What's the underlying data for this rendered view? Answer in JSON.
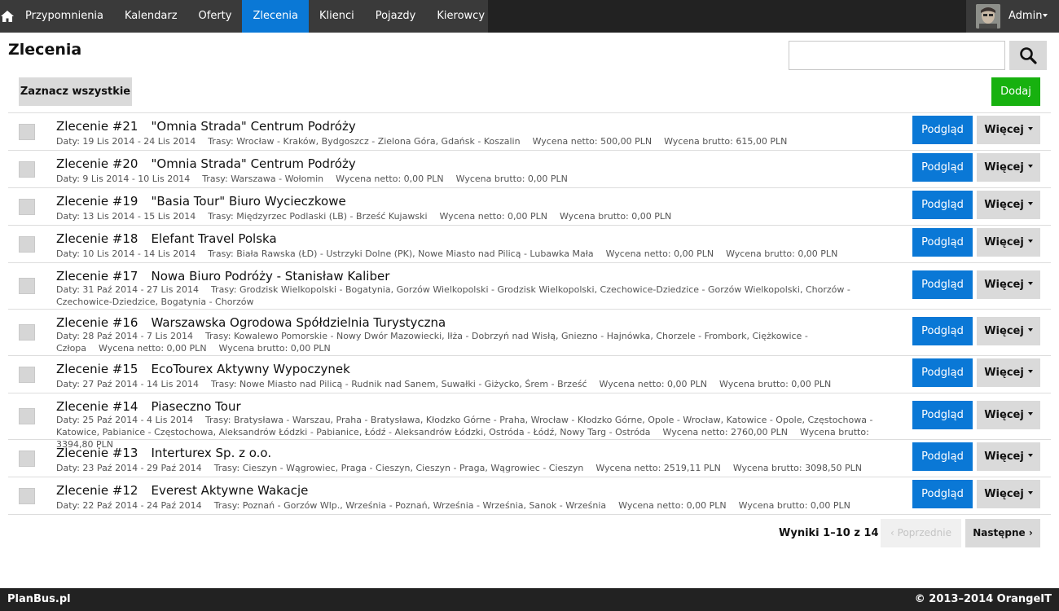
{
  "nav": {
    "home_icon": "home-icon",
    "items": [
      "Przypomnienia",
      "Kalendarz",
      "Oferty",
      "Zlecenia",
      "Klienci",
      "Pojazdy",
      "Kierowcy"
    ],
    "active": "Zlecenia",
    "active_color": "#0a78d6"
  },
  "user": {
    "name": "Admin",
    "menu_icon": "caret-down-icon"
  },
  "page": {
    "title": "Zlecenia"
  },
  "search": {
    "placeholder": "",
    "value": "",
    "icon": "search-icon"
  },
  "toolbar": {
    "select_all_label": "Zaznacz wszystkie",
    "add_label": "Dodaj",
    "add_color": "#17b10f"
  },
  "orders": [
    {
      "number": "Zlecenie #21",
      "client": "\"Omnia Strada\" Centrum Podróży",
      "dates": "Daty: 19 Lis 2014 - 24 Lis 2014",
      "routes": "Trasy: Wrocław - Kraków, Bydgoszcz - Zielona Góra, Gdańsk - Koszalin",
      "netto": "Wycena netto: 500,00 PLN",
      "brutto": "Wycena brutto: 615,00 PLN",
      "preview_label": "Podgląd",
      "more_label": "Więcej"
    },
    {
      "number": "Zlecenie #20",
      "client": "\"Omnia Strada\" Centrum Podróży",
      "dates": "Daty: 9 Lis 2014 - 10 Lis 2014",
      "routes": "Trasy: Warszawa - Wołomin",
      "netto": "Wycena netto: 0,00 PLN",
      "brutto": "Wycena brutto: 0,00 PLN",
      "preview_label": "Podgląd",
      "more_label": "Więcej"
    },
    {
      "number": "Zlecenie #19",
      "client": "\"Basia Tour\" Biuro Wycieczkowe",
      "dates": "Daty: 13 Lis 2014 - 15 Lis 2014",
      "routes": "Trasy: Międzyrzec Podlaski (LB) - Brześć Kujawski",
      "netto": "Wycena netto: 0,00 PLN",
      "brutto": "Wycena brutto: 0,00 PLN",
      "preview_label": "Podgląd",
      "more_label": "Więcej"
    },
    {
      "number": "Zlecenie #18",
      "client": "Elefant Travel Polska",
      "dates": "Daty: 10 Lis 2014 - 14 Lis 2014",
      "routes": "Trasy: Biała Rawska (ŁD) - Ustrzyki Dolne (PK), Nowe Miasto nad Pilicą - Lubawka Mała",
      "netto": "Wycena netto: 0,00 PLN",
      "brutto": "Wycena brutto: 0,00 PLN",
      "preview_label": "Podgląd",
      "more_label": "Więcej"
    },
    {
      "number": "Zlecenie #17",
      "client": "Nowa Biuro Podróży - Stanisław Kaliber",
      "dates": "Daty: 31 Paź 2014 - 27 Lis 2014",
      "routes": "Trasy: Grodzisk Wielkopolski - Bogatynia, Gorzów Wielkopolski - Grodzisk Wielkopolski, Czechowice-Dziedzice - Gorzów Wielkopolski, Chorzów - Czechowice-Dziedzice, Bogatynia - Chorzów",
      "netto": "",
      "brutto": "",
      "preview_label": "Podgląd",
      "more_label": "Więcej"
    },
    {
      "number": "Zlecenie #16",
      "client": "Warszawska Ogrodowa Spółdzielnia Turystyczna",
      "dates": "Daty: 28 Paź 2014 - 7 Lis 2014",
      "routes": "Trasy: Kowalewo Pomorskie - Nowy Dwór Mazowiecki, Iłża - Dobrzyń nad Wisłą, Gniezno - Hajnówka, Chorzele - Frombork, Ciężkowice - Człopa",
      "netto": "Wycena netto: 0,00 PLN",
      "brutto": "Wycena brutto: 0,00 PLN",
      "preview_label": "Podgląd",
      "more_label": "Więcej"
    },
    {
      "number": "Zlecenie #15",
      "client": "EcoTourex Aktywny Wypoczynek",
      "dates": "Daty: 27 Paź 2014 - 14 Lis 2014",
      "routes": "Trasy: Nowe Miasto nad Pilicą - Rudnik nad Sanem, Suwałki - Giżycko, Śrem - Brześć",
      "netto": "Wycena netto: 0,00 PLN",
      "brutto": "Wycena brutto: 0,00 PLN",
      "preview_label": "Podgląd",
      "more_label": "Więcej"
    },
    {
      "number": "Zlecenie #14",
      "client": "Piaseczno Tour",
      "dates": "Daty: 25 Paź 2014 - 4 Lis 2014",
      "routes": "Trasy: Bratysława - Warszau, Praha - Bratysława, Kłodzko Górne - Praha, Wrocław - Kłodzko Górne, Opole - Wrocław, Katowice - Opole, Częstochowa - Katowice, Pabianice - Częstochowa, Aleksandrów Łódzki - Pabianice, Łódź - Aleksandrów Łódzki, Ostróda - Łódź, Nowy Targ - Ostróda",
      "netto": "Wycena netto: 2760,00 PLN",
      "brutto": "Wycena brutto: 3394,80 PLN",
      "preview_label": "Podgląd",
      "more_label": "Więcej"
    },
    {
      "number": "Zlecenie #13",
      "client": "Interturex Sp. z o.o.",
      "dates": "Daty: 23 Paź 2014 - 29 Paź 2014",
      "routes": "Trasy: Cieszyn - Wągrowiec, Praga - Cieszyn, Cieszyn - Praga, Wągrowiec - Cieszyn",
      "netto": "Wycena netto: 2519,11 PLN",
      "brutto": "Wycena brutto: 3098,50 PLN",
      "preview_label": "Podgląd",
      "more_label": "Więcej"
    },
    {
      "number": "Zlecenie #12",
      "client": "Everest Aktywne Wakacje",
      "dates": "Daty: 22 Paź 2014 - 24 Paź 2014",
      "routes": "Trasy: Poznań - Gorzów Wlp., Września - Poznań, Września - Września, Sanok - Września",
      "netto": "Wycena netto: 0,00 PLN",
      "brutto": "Wycena brutto: 0,00 PLN",
      "preview_label": "Podgląd",
      "more_label": "Więcej"
    }
  ],
  "pagination": {
    "results": "Wyniki 1–10 z 14",
    "prev_label": "‹ Poprzednie",
    "next_label": "Następne ›"
  },
  "footer": {
    "brand": "PlanBus.pl",
    "copyright": "© 2013–2014 OrangeIT"
  },
  "colors": {
    "primary": "#0a78d6",
    "success": "#17b10f",
    "topbar": "#222222"
  }
}
